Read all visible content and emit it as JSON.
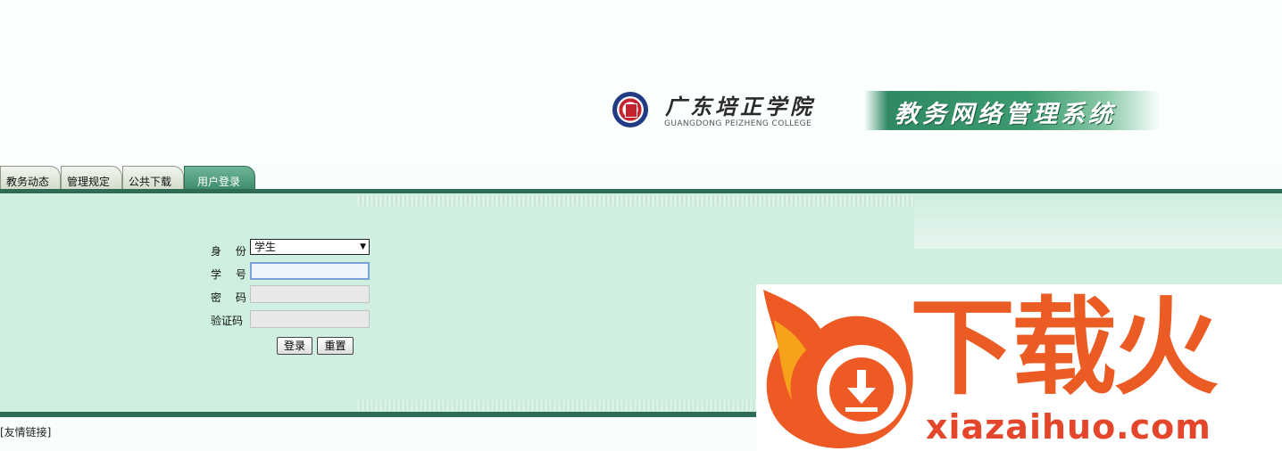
{
  "header": {
    "college_cn": "广东培正学院",
    "college_en": "GUANGDONG PEIZHENG COLLEGE",
    "system_title": "教务网络管理系统"
  },
  "tabs": [
    {
      "label": "教务动态",
      "active": false
    },
    {
      "label": "管理规定",
      "active": false
    },
    {
      "label": "公共下载",
      "active": false
    },
    {
      "label": "用户登录",
      "active": true
    }
  ],
  "login": {
    "identity_label": "身 份",
    "identity_value": "学生",
    "id_label": "学 号",
    "id_value": "",
    "password_label": "密 码",
    "password_value": "",
    "captcha_label": "验证码",
    "captcha_value": "",
    "login_button": "登录",
    "reset_button": "重置"
  },
  "footer": {
    "friend_links": "[友情链接]"
  },
  "watermark": {
    "cn": "下载火",
    "en": "xiazaihuo.com"
  },
  "colors": {
    "tab_active": "#4f9e7d",
    "panel_bg": "#cff0e0",
    "rule": "#2f6c55",
    "watermark_orange": "#eb5b24"
  }
}
